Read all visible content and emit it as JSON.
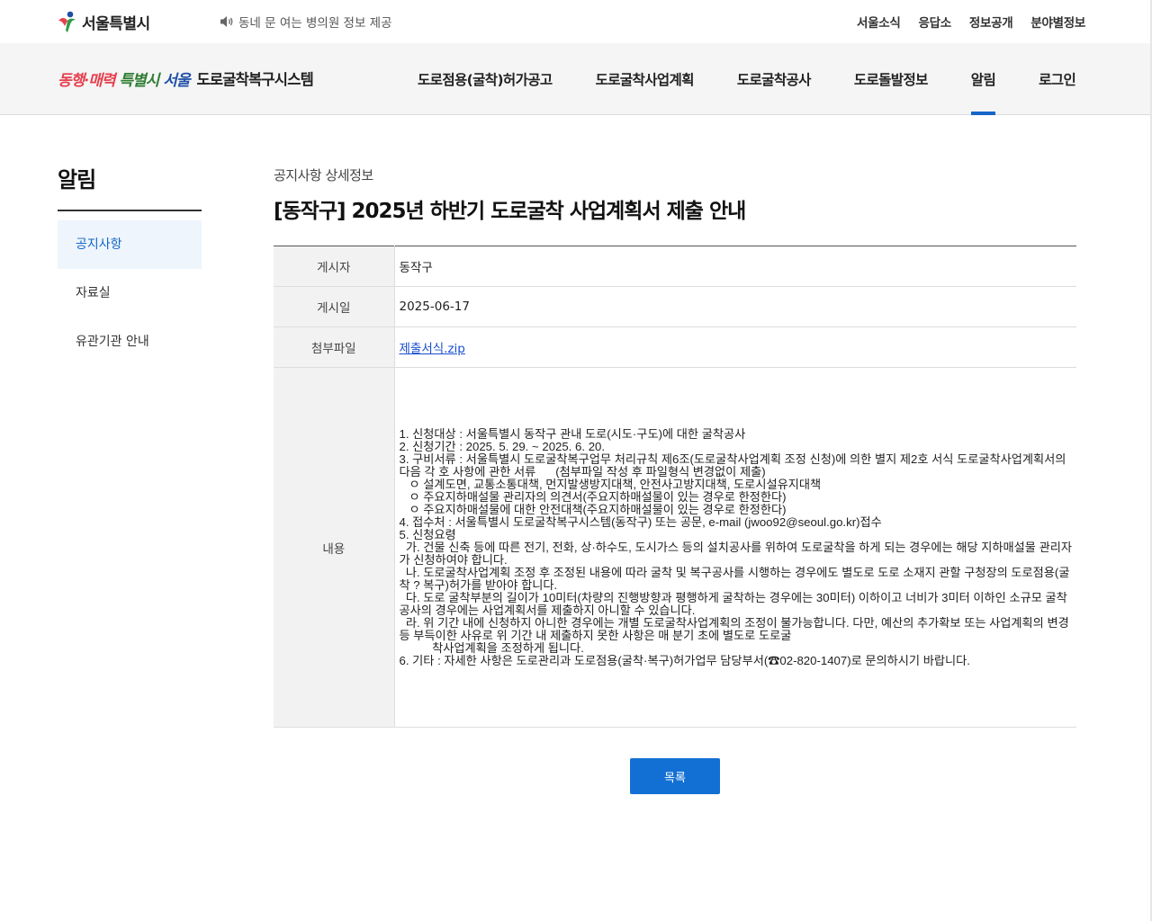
{
  "topbar": {
    "logo_text": "서울특별시",
    "notice": "동네 문 여는 병의원 정보 제공",
    "util_menu": [
      "서울소식",
      "응답소",
      "정보공개",
      "분야별정보"
    ]
  },
  "header": {
    "slogan": [
      "동행",
      "·매력 ",
      "특별시 ",
      "서울"
    ],
    "system_name": "도로굴착복구시스템",
    "gnb": [
      "도로점용(굴착)허가공고",
      "도로굴착사업계획",
      "도로굴착공사",
      "도로돌발정보",
      "알림",
      "로그인"
    ],
    "active_index": 4
  },
  "sidebar": {
    "title": "알림",
    "items": [
      "공지사항",
      "자료실",
      "유관기관 안내"
    ],
    "active_index": 0
  },
  "main": {
    "sub_title": "공지사항 상세정보",
    "title": "[동작구] 2025년 하반기 도로굴착 사업계획서 제출 안내",
    "fields": {
      "author_label": "게시자",
      "author": "동작구",
      "date_label": "게시일",
      "date": "2025-06-17",
      "attach_label": "첨부파일",
      "attach": "제출서식.zip",
      "body_label": "내용"
    },
    "body": "1. 신청대상 : 서울특별시 동작구 관내 도로(시도·구도)에 대한 굴착공사\n2. 신청기간 : 2025. 5. 29. ~ 2025. 6. 20.\n3. 구비서류 : 서울특별시 도로굴착복구업무 처리규칙 제6조(도로굴착사업계획 조정 신청)에 의한 별지 제2호 서식 도로굴착사업계획서의 다음 각 호 사항에 관한 서류      (첨부파일 작성 후 파일형식 변경없이 제출)\n   ㅇ 설계도면, 교통소통대책, 먼지발생방지대책, 안전사고방지대책, 도로시설유지대책\n   ㅇ 주요지하매설물 관리자의 의견서(주요지하매설물이 있는 경우로 한정한다)\n   ㅇ 주요지하매설물에 대한 안전대책(주요지하매설물이 있는 경우로 한정한다)\n4. 접수처 : 서울특별시 도로굴착복구시스템(동작구) 또는 공문, e-mail (jwoo92@seoul.go.kr)접수\n5. 신청요령\n  가. 건물 신축 등에 따른 전기, 전화, 상·하수도, 도시가스 등의 설치공사를 위하여 도로굴착을 하게 되는 경우에는 해당 지하매설물 관리자가 신청하여야 합니다.\n  나. 도로굴착사업계획 조정 후 조정된 내용에 따라 굴착 및 복구공사를 시행하는 경우에도 별도로 도로 소재지 관할 구청장의 도로점용(굴착 ? 복구)허가를 받아야 합니다.\n  다. 도로 굴착부분의 길이가 10미터(차량의 진행방향과 평행하게 굴착하는 경우에는 30미터) 이하이고 너비가 3미터 이하인 소규모 굴착공사의 경우에는 사업계획서를 제출하지 아니할 수 있습니다.\n  라. 위 기간 내에 신청하지 아니한 경우에는 개별 도로굴착사업계획의 조정이 불가능합니다. 다만, 예산의 추가확보 또는 사업계획의 변경 등 부득이한 사유로 위 기간 내 제출하지 못한 사항은 매 분기 초에 별도로 도로굴\n          착사업계획을 조정하게 됩니다.\n6. 기타 : 자세한 사항은 도로관리과 도로점용(굴착·복구)허가업무 담당부서(☎02-820-1407)로 문의하시기 바랍니다.",
    "list_button": "목록"
  },
  "colors": {
    "accent": "#1466c8",
    "button": "#1270d4",
    "sidebar_active_bg": "#eef5fc"
  }
}
